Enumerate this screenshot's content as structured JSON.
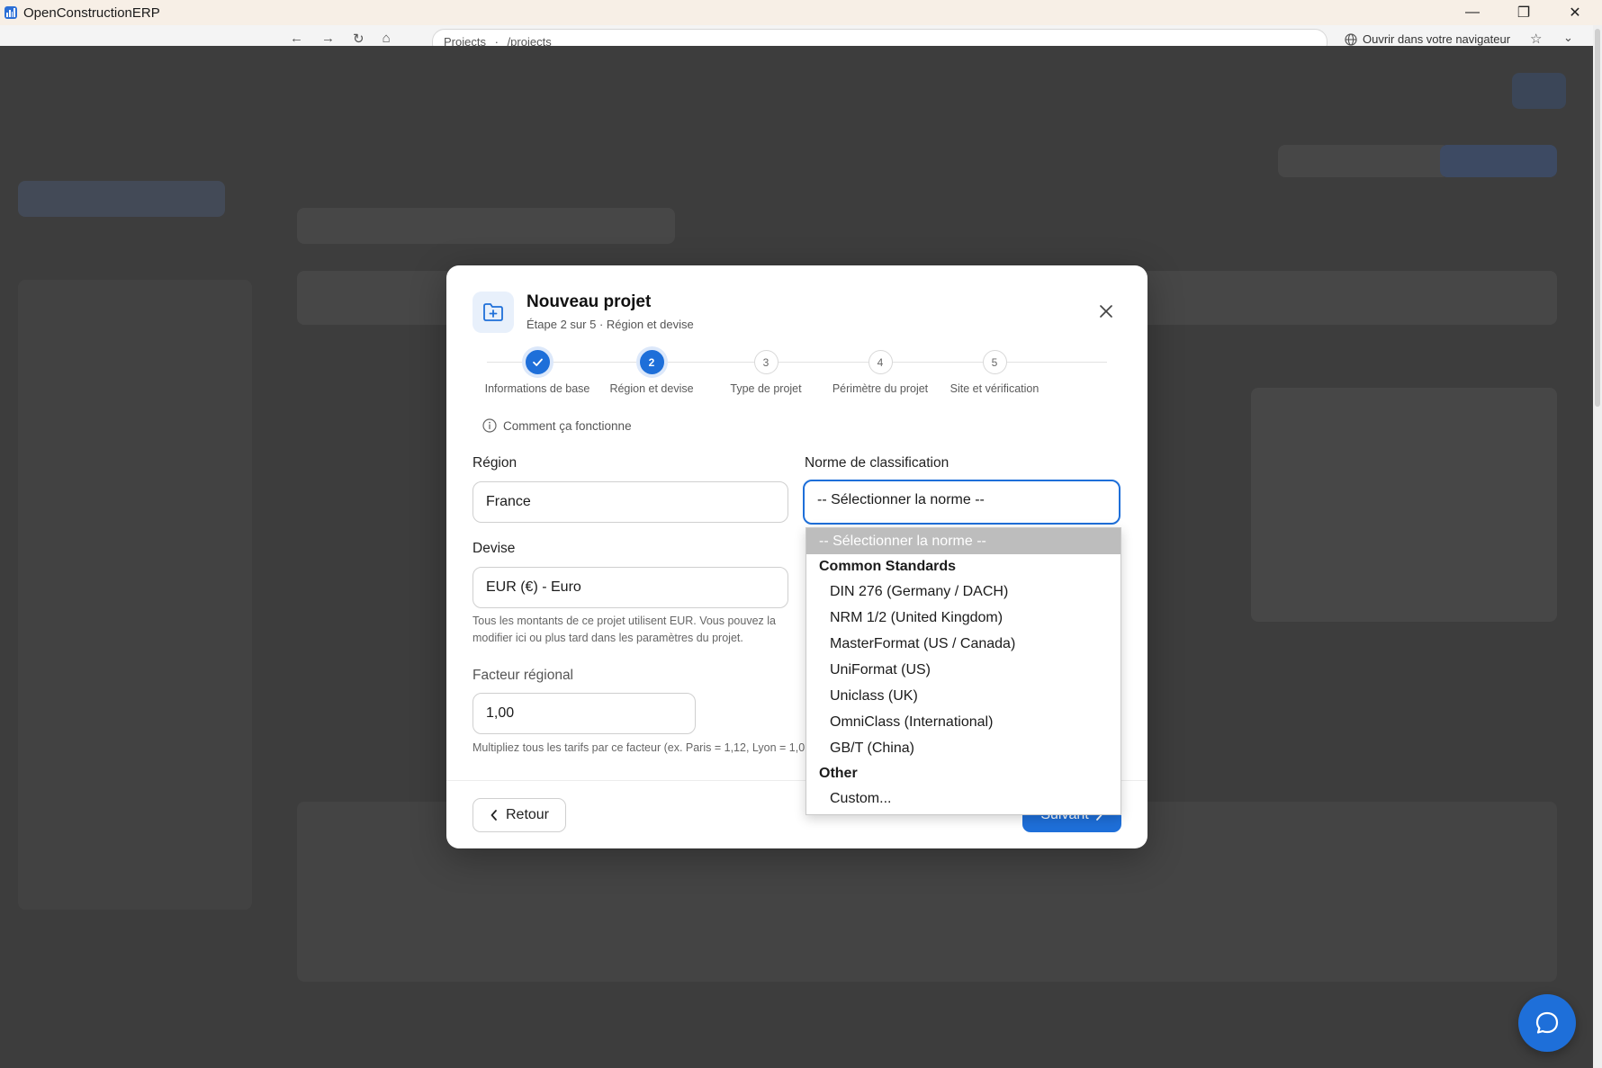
{
  "window": {
    "title": "OpenConstructionERP",
    "controls": {
      "minimize": "—",
      "restore": "❐",
      "close": "✕"
    }
  },
  "browser": {
    "address_parts": [
      "Projects",
      "·",
      "/projects"
    ],
    "open_in_browser": "Ouvrir dans votre navigateur"
  },
  "modal": {
    "title": "Nouveau projet",
    "subtitle": "Étape 2 sur 5 · Région et devise",
    "steps": [
      {
        "number": "1",
        "label": "Informations de base",
        "state": "done"
      },
      {
        "number": "2",
        "label": "Région et devise",
        "state": "active"
      },
      {
        "number": "3",
        "label": "Type de projet",
        "state": "pending"
      },
      {
        "number": "4",
        "label": "Périmètre du projet",
        "state": "pending"
      },
      {
        "number": "5",
        "label": "Site et vérification",
        "state": "pending"
      }
    ],
    "how_it_works": "Comment ça fonctionne",
    "region": {
      "label": "Région",
      "value": "France"
    },
    "classification": {
      "label": "Norme de classification",
      "value": "-- Sélectionner la norme --"
    },
    "currency": {
      "label": "Devise",
      "value": "EUR (€) - Euro",
      "hint": "Tous les montants de ce projet utilisent EUR. Vous pouvez la modifier ici ou plus tard dans les paramètres du projet."
    },
    "regional_factor": {
      "label": "Facteur régional",
      "value": "1,00",
      "hint": "Multipliez tous les tarifs par ce facteur (ex. Paris = 1,12, Lyon = 1,0"
    },
    "back_label": "Retour",
    "next_label": "Suivant"
  },
  "dropdown": {
    "selected": "-- Sélectionner la norme --",
    "group1": "Common Standards",
    "items": [
      "DIN 276 (Germany / DACH)",
      "NRM 1/2 (United Kingdom)",
      "MasterFormat (US / Canada)",
      "UniFormat (US)",
      "Uniclass (UK)",
      "OmniClass (International)",
      "GB/T (China)"
    ],
    "group2": "Other",
    "custom": "Custom..."
  },
  "colors": {
    "accent": "#1e6fd9",
    "overlay": "#3d3d3d",
    "titlebar": "#f7efe6"
  }
}
